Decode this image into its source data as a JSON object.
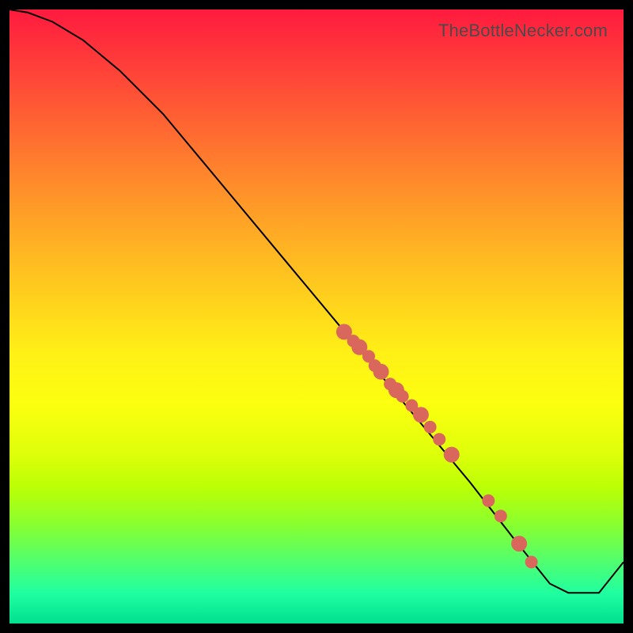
{
  "attribution": "TheBottleNecker.com",
  "chart_data": {
    "type": "line",
    "title": "",
    "xlabel": "",
    "ylabel": "",
    "xlim": [
      0,
      100
    ],
    "ylim": [
      0,
      100
    ],
    "series": [
      {
        "name": "curve",
        "x": [
          0.0,
          3.0,
          7.0,
          12.0,
          18.0,
          25.0,
          35.0,
          45.0,
          55.0,
          65.0,
          75.0,
          82.0,
          86.0,
          88.0,
          91.0,
          96.0,
          100.0
        ],
        "y": [
          100.0,
          99.5,
          98.0,
          95.0,
          90.0,
          83.0,
          71.0,
          59.0,
          47.0,
          35.0,
          23.0,
          14.0,
          9.0,
          6.5,
          5.0,
          5.0,
          10.0
        ]
      }
    ],
    "markers": {
      "name": "data-points",
      "x": [
        54.5,
        56.0,
        57.0,
        58.5,
        59.5,
        60.5,
        62.0,
        63.0,
        64.0,
        65.5,
        67.0,
        68.5,
        70.0,
        72.0,
        78.0,
        80.0,
        83.0,
        85.0
      ],
      "y": [
        47.5,
        46.0,
        45.0,
        43.5,
        42.0,
        41.0,
        39.0,
        38.0,
        37.0,
        35.5,
        34.0,
        32.0,
        30.0,
        27.5,
        20.0,
        17.5,
        13.0,
        10.0
      ],
      "radius": [
        10,
        8,
        10,
        8,
        8,
        10,
        8,
        10,
        8,
        8,
        10,
        8,
        8,
        10,
        8,
        8,
        10,
        8
      ]
    },
    "colors": {
      "gradient_top": "#ff1a3f",
      "gradient_bottom": "#00e090",
      "line": "#000000",
      "marker": "#d9675c",
      "frame": "#000000"
    }
  }
}
